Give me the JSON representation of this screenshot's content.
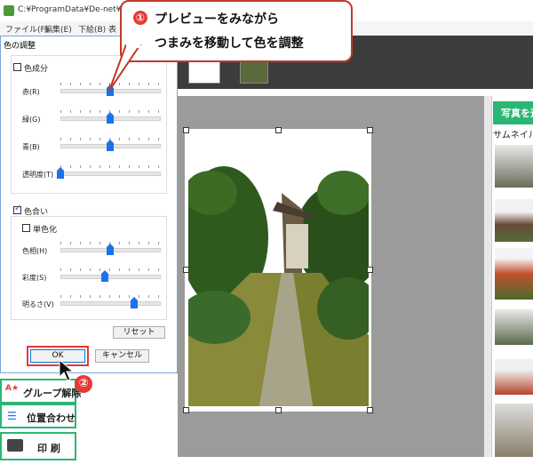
{
  "window": {
    "title": "C:¥ProgramData¥De-net¥raku"
  },
  "menu": {
    "items": [
      "ファイル(F)",
      "編集(E)",
      "下絵(B)",
      "表"
    ]
  },
  "dialog": {
    "title": "色の調整",
    "group1": {
      "checkbox_label": "色成分",
      "checked": false,
      "sliders": [
        {
          "label": "赤(R)",
          "value": 0.5
        },
        {
          "label": "緑(G)",
          "value": 0.5
        },
        {
          "label": "青(B)",
          "value": 0.5
        },
        {
          "label": "透明度(T)",
          "value": 0.0
        }
      ]
    },
    "group2": {
      "checkbox_label": "色合い",
      "checked": true,
      "mono_label": "単色化",
      "mono_checked": false,
      "sliders": [
        {
          "label": "色相(H)",
          "value": 0.5
        },
        {
          "label": "彩度(S)",
          "value": 0.45
        },
        {
          "label": "明るさ(V)",
          "value": 0.75
        }
      ]
    },
    "reset_label": "リセット",
    "ok_label": "OK",
    "cancel_label": "キャンセル"
  },
  "left_buttons": {
    "ungroup": "グループ解除",
    "align": "位置合わせ",
    "print": "印 刷"
  },
  "right_panel": {
    "photo_button": "写真を追",
    "thumb_label": "サムネイル"
  },
  "callout1": {
    "number": "①",
    "line1": "プレビューをみながら",
    "line2": "つまみを移動して色を調整"
  },
  "callout2": {
    "number": "②"
  },
  "colors": {
    "accent": "#2bb673",
    "callout": "#e53935",
    "slider_thumb": "#1a73e8"
  }
}
